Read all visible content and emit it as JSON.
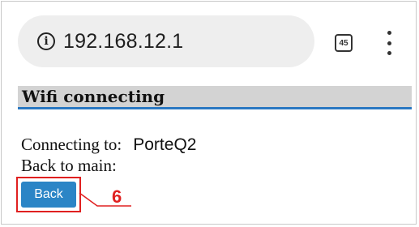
{
  "browser": {
    "url": "192.168.12.1",
    "tab_count": "45",
    "icons": {
      "site_info": "info-icon",
      "tabs": "tabs-icon",
      "menu": "more-vert-icon"
    }
  },
  "page": {
    "heading": "Wifi connecting",
    "connecting_label": "Connecting to:",
    "connecting_value": "PorteQ2",
    "back_label": "Back to main:",
    "back_button": "Back"
  },
  "annotation": {
    "step_number": "6",
    "color": "#e02020"
  },
  "colors": {
    "heading_underline": "#2a78c2",
    "button_bg": "#2b85c6",
    "urlbar_bg": "#eeeeee"
  }
}
